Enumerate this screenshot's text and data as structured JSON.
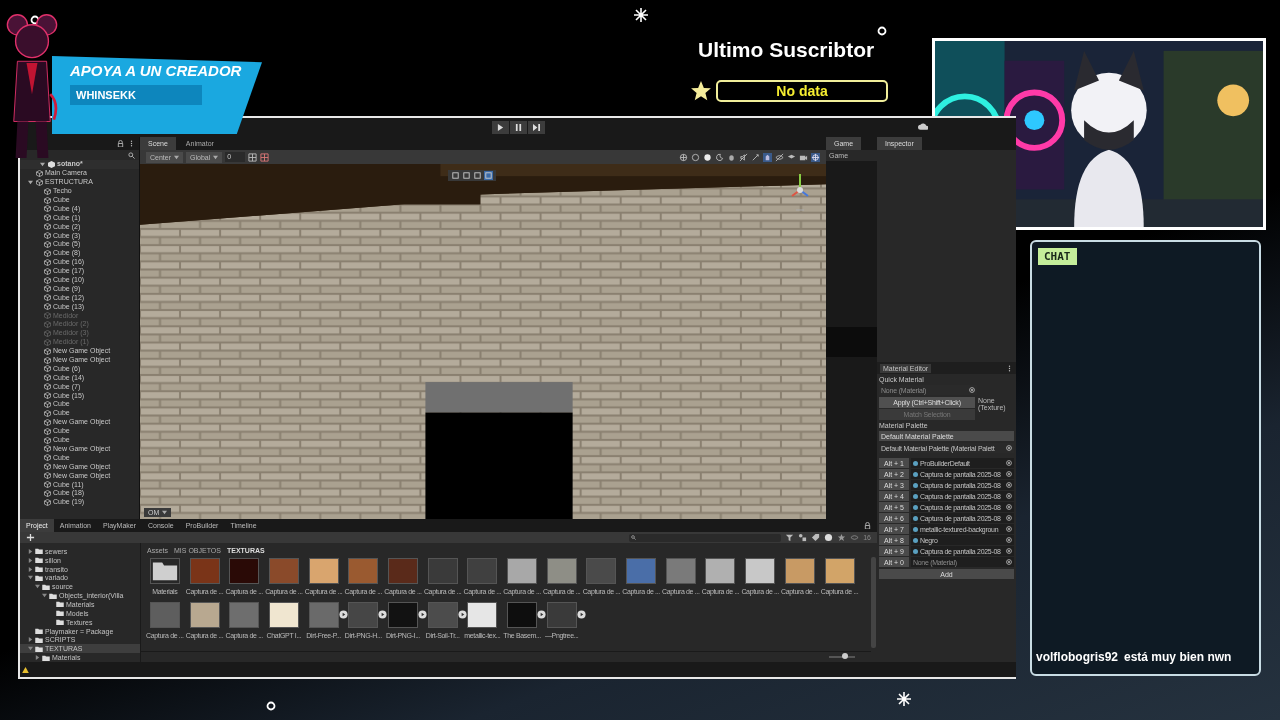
{
  "overlay": {
    "support_title": "APOYA A UN CREADOR",
    "support_name": "WHINSEKK",
    "subscriber_title": "Ultimo Suscribtor",
    "subscriber_value": "No data",
    "chat_label": "CHAT",
    "chat_messages": [
      {
        "user": "volflobogris92",
        "text": "está muy bien nwn"
      }
    ]
  },
  "editor": {
    "scene_tabs": [
      {
        "label": "Scene",
        "selected": true
      },
      {
        "label": "Animator",
        "selected": false
      }
    ],
    "game_tab": "Game",
    "game_display": "Game",
    "inspector_tab": "Inspector",
    "scene_toolbar": {
      "pivot": "Center",
      "space": "Global",
      "snap_value": "0"
    },
    "scene_camera_button": "OM",
    "hierarchy": {
      "scene": {
        "label": "sotano*",
        "expanded": true
      },
      "items": [
        {
          "label": "Main Camera",
          "active": true
        },
        {
          "label": "ESTRUCTURA",
          "active": true,
          "expanded": true,
          "children": [
            {
              "label": "Techo",
              "active": true
            },
            {
              "label": "Cube",
              "active": true
            },
            {
              "label": "Cube (4)",
              "active": true
            },
            {
              "label": "Cube (1)",
              "active": true
            },
            {
              "label": "Cube (2)",
              "active": true
            },
            {
              "label": "Cube (3)",
              "active": true
            },
            {
              "label": "Cube (5)",
              "active": true
            },
            {
              "label": "Cube (8)",
              "active": true
            },
            {
              "label": "Cube (16)",
              "active": true
            },
            {
              "label": "Cube (17)",
              "active": true
            },
            {
              "label": "Cube (10)",
              "active": true
            },
            {
              "label": "Cube (9)",
              "active": true
            },
            {
              "label": "Cube (12)",
              "active": true
            },
            {
              "label": "Cube (13)",
              "active": true
            },
            {
              "label": "Medidor",
              "active": false
            },
            {
              "label": "Medidor (2)",
              "active": false
            },
            {
              "label": "Medidor (3)",
              "active": false
            },
            {
              "label": "Medidor (1)",
              "active": false
            },
            {
              "label": "New Game Object",
              "active": true
            },
            {
              "label": "New Game Object",
              "active": true
            },
            {
              "label": "Cube (6)",
              "active": true
            },
            {
              "label": "Cube (14)",
              "active": true
            },
            {
              "label": "Cube (7)",
              "active": true
            },
            {
              "label": "Cube (15)",
              "active": true
            },
            {
              "label": "Cube",
              "active": true
            },
            {
              "label": "Cube",
              "active": true
            },
            {
              "label": "New Game Object",
              "active": true
            },
            {
              "label": "Cube",
              "active": true
            },
            {
              "label": "Cube",
              "active": true
            },
            {
              "label": "New Game Object",
              "active": true
            },
            {
              "label": "Cube",
              "active": true
            },
            {
              "label": "New Game Object",
              "active": true
            },
            {
              "label": "New Game Object",
              "active": true
            },
            {
              "label": "Cube (11)",
              "active": true
            },
            {
              "label": "Cube (18)",
              "active": true
            },
            {
              "label": "Cube (19)",
              "active": true
            }
          ]
        }
      ]
    },
    "bottom_tabs": [
      {
        "label": "Project",
        "selected": true
      },
      {
        "label": "Animation",
        "selected": false
      },
      {
        "label": "PlayMaker",
        "selected": false
      },
      {
        "label": "Console",
        "selected": false
      },
      {
        "label": "ProBuilder",
        "selected": false
      },
      {
        "label": "Timeline",
        "selected": false
      }
    ],
    "visible_count": "16",
    "folders": [
      {
        "label": "sewers",
        "selected": false,
        "expanded": false
      },
      {
        "label": "sillon",
        "selected": false,
        "expanded": false
      },
      {
        "label": "transito",
        "selected": false,
        "expanded": false
      },
      {
        "label": "variado",
        "selected": false,
        "expanded": true,
        "children": [
          {
            "label": "source",
            "selected": false,
            "expanded": true,
            "children": [
              {
                "label": "Objects_interior(Villa",
                "selected": false,
                "expanded": true,
                "children": [
                  {
                    "label": "Materials",
                    "selected": false
                  },
                  {
                    "label": "Models",
                    "selected": false
                  },
                  {
                    "label": "Textures",
                    "selected": false
                  }
                ]
              }
            ]
          }
        ]
      },
      {
        "label": "Playmaker = Package",
        "selected": false
      },
      {
        "label": "SCRIPTS",
        "selected": false,
        "expanded": false
      },
      {
        "label": "TEXTURAS",
        "selected": true,
        "expanded": true,
        "children": [
          {
            "label": "Materials",
            "selected": false,
            "expanded": false
          }
        ]
      }
    ],
    "breadcrumb": [
      "Assets",
      "MIS OBJETOS",
      "TEXTURAS"
    ],
    "assets": [
      {
        "kind": "folder",
        "label": "Materials",
        "color": "#cfcfcf",
        "expandable": false
      },
      {
        "kind": "texture",
        "label": "Captura de ...",
        "color": "#7a3418",
        "expandable": false
      },
      {
        "kind": "texture",
        "label": "Captura de ...",
        "color": "#2a0a06",
        "expandable": false
      },
      {
        "kind": "texture",
        "label": "Captura de ...",
        "color": "#8a4a2a",
        "expandable": false
      },
      {
        "kind": "texture",
        "label": "Captura de ...",
        "color": "#d9a56e",
        "expandable": false
      },
      {
        "kind": "texture",
        "label": "Captura de ...",
        "color": "#9a5a30",
        "expandable": false
      },
      {
        "kind": "texture",
        "label": "Captura de ...",
        "color": "#5a2a1a",
        "expandable": false
      },
      {
        "kind": "texture",
        "label": "Captura de ...",
        "color": "#3a3a3a",
        "expandable": false
      },
      {
        "kind": "texture",
        "label": "Captura de ...",
        "color": "#404040",
        "expandable": false
      },
      {
        "kind": "texture",
        "label": "Captura de ...",
        "color": "#a8a8a8",
        "expandable": false
      },
      {
        "kind": "texture",
        "label": "Captura de ...",
        "color": "#8e8e86",
        "expandable": false
      },
      {
        "kind": "texture",
        "label": "Captura de ...",
        "color": "#4a4a4a",
        "expandable": false
      },
      {
        "kind": "texture",
        "label": "Captura de ...",
        "color": "#4a6ea8",
        "expandable": false
      },
      {
        "kind": "texture",
        "label": "Captura de ...",
        "color": "#7a7a7a",
        "expandable": false
      },
      {
        "kind": "texture",
        "label": "Captura de ...",
        "color": "#b0b0b0",
        "expandable": false
      },
      {
        "kind": "texture",
        "label": "Captura de ...",
        "color": "#c8c8c8",
        "expandable": false
      },
      {
        "kind": "texture",
        "label": "Captura de ...",
        "color": "#c89a64",
        "expandable": false
      },
      {
        "kind": "texture",
        "label": "Captura de ...",
        "color": "#d2a468",
        "expandable": false
      },
      {
        "kind": "texture",
        "label": "Captura de ...",
        "color": "#5e5e5e",
        "expandable": false
      },
      {
        "kind": "texture",
        "label": "Captura de ...",
        "color": "#b8a890",
        "expandable": false
      },
      {
        "kind": "texture",
        "label": "Captura de ...",
        "color": "#6e6e6e",
        "expandable": false
      },
      {
        "kind": "texture",
        "label": "ChatGPT I...",
        "color": "#f0e6d0",
        "expandable": false
      },
      {
        "kind": "texture",
        "label": "Dirt-Free-P...",
        "color": "#6a6a6a",
        "expandable": true
      },
      {
        "kind": "texture",
        "label": "Dirt-PNG-H...",
        "color": "#464646",
        "expandable": true
      },
      {
        "kind": "texture",
        "label": "Dirt-PNG-I...",
        "color": "#121212",
        "expandable": true
      },
      {
        "kind": "texture",
        "label": "Dirt-Soil-Tr...",
        "color": "#4c4c4c",
        "expandable": true
      },
      {
        "kind": "texture",
        "label": "metallic-tex...",
        "color": "#e6e6e6",
        "expandable": false
      },
      {
        "kind": "texture",
        "label": "The Basem...",
        "color": "#0e0e0e",
        "expandable": true
      },
      {
        "kind": "texture",
        "label": "—Pngtree...",
        "color": "#3a3a3a",
        "expandable": true
      }
    ],
    "thumb_size": {
      "level": 0.6
    },
    "material_editor": {
      "title": "Material Editor",
      "quick_label": "Quick Material",
      "quick_field": "None (Material)",
      "apply_button": "Apply (Ctrl+Shift+Click)",
      "texture_label": "None (Texture)",
      "match_button": "Match Selection",
      "match_disabled": true,
      "palette_label": "Material Palette",
      "palette_dropdown": "Default Material Palette",
      "palette_field": "Default Material Palette (Material Palett",
      "slots": [
        {
          "key": "Alt + 1",
          "material": "ProBuilderDefault",
          "assigned": true
        },
        {
          "key": "Alt + 2",
          "material": "Captura de pantalla 2025-08",
          "assigned": true
        },
        {
          "key": "Alt + 3",
          "material": "Captura de pantalla 2025-08",
          "assigned": true
        },
        {
          "key": "Alt + 4",
          "material": "Captura de pantalla 2025-08",
          "assigned": true
        },
        {
          "key": "Alt + 5",
          "material": "Captura de pantalla 2025-08",
          "assigned": true
        },
        {
          "key": "Alt + 6",
          "material": "Captura de pantalla 2025-08",
          "assigned": true
        },
        {
          "key": "Alt + 7",
          "material": "metallic-textured-backgroun",
          "assigned": true
        },
        {
          "key": "Alt + 8",
          "material": "Negro",
          "assigned": true
        },
        {
          "key": "Alt + 9",
          "material": "Captura de pantalla 2025-08",
          "assigned": true
        },
        {
          "key": "Alt + 0",
          "material": "None (Material)",
          "assigned": false
        }
      ],
      "add_button": "Add"
    }
  }
}
